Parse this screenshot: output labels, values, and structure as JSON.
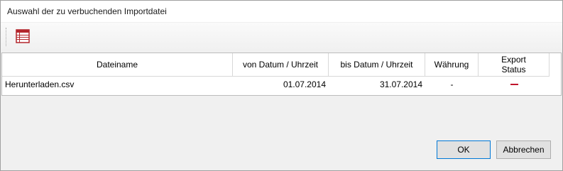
{
  "window": {
    "title": "Auswahl der zu verbuchenden Importdatei"
  },
  "toolbar": {
    "buttons": [
      {
        "icon": "list-icon"
      }
    ]
  },
  "table": {
    "columns": [
      "Dateiname",
      "von Datum / Uhrzeit",
      "bis Datum / Uhrzeit",
      "Währung",
      "Export\nStatus"
    ],
    "rows": [
      {
        "dateiname": "Herunterladen.csv",
        "von": "01.07.2014",
        "bis": "31.07.2014",
        "waehrung": "-",
        "status_color": "#c0142c"
      }
    ]
  },
  "buttons": {
    "ok": "OK",
    "cancel": "Abbrechen"
  }
}
